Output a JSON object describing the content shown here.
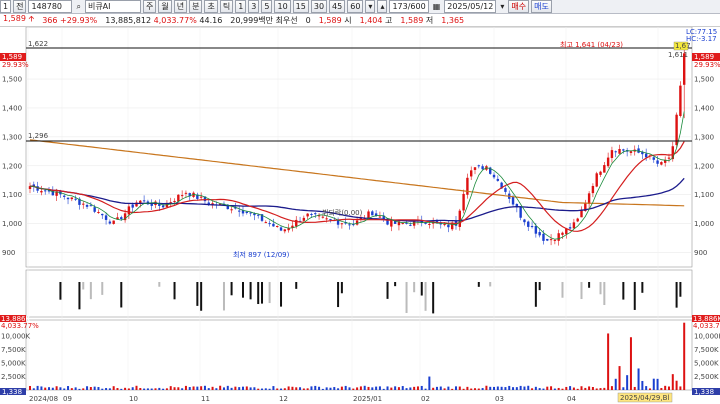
{
  "toolbar": {
    "period_selector": "1",
    "symbol_type": "전",
    "code": "148780",
    "name": "비큐AI",
    "periods": [
      "주",
      "월",
      "년",
      "분",
      "초",
      "틱"
    ],
    "intervals": [
      "1",
      "3",
      "5",
      "10",
      "15",
      "30",
      "45",
      "60"
    ],
    "counter": "173/600",
    "date": "2025/05/12",
    "buy_label": "매수",
    "sell_label": "매도"
  },
  "quote": {
    "price": "1,589",
    "change": "366",
    "change_pct": "+29.93%",
    "volume": "13,885,812",
    "volume_pct": "4,033.77%",
    "turnover_ratio": "44.16",
    "amount": "20,999백만",
    "priority_label": "최우선",
    "priority_value": "0",
    "open_value": "1,589",
    "open_label": "시",
    "high_value": "1,404",
    "high_label": "고",
    "low_value": "1,589",
    "low_label": "저",
    "low2_value": "1,365"
  },
  "indicators": {
    "lc": "LC:77.15",
    "hc": "HC:-3.17"
  },
  "price_axis": {
    "ticks": [
      "1,500",
      "1,400",
      "1,300",
      "1,200",
      "1,100",
      "1,000",
      "900"
    ],
    "current_price_tag": "1,589",
    "current_pct_tag": "29.93%",
    "high_tag": "1,67",
    "high_tag2": "1,611"
  },
  "annotations": {
    "line_1622": "1,622",
    "line_1296": "1,296",
    "highest": "최고 1,641 (04/23)",
    "lowest": "최저 897 (12/09)",
    "note": "뷔되락(0.00)"
  },
  "volume_axis": {
    "ticks": [
      "10,000K",
      "7,500K",
      "5,000K",
      "2,500K"
    ],
    "left_tag": "4,033.77%",
    "left_tag_vol": "13,886K",
    "right_tag_vol": "13,886K",
    "right_tag_pct": "4,033.77%",
    "bottom_left": "1,338",
    "bottom_right": "1,338"
  },
  "time_axis": {
    "labels": [
      "2024/08",
      "09",
      "10",
      "11",
      "12",
      "2025/01",
      "02",
      "03",
      "04",
      "05"
    ],
    "cursor_label": "2025/04/29,Bl"
  },
  "colors": {
    "up": "#dd1111",
    "down": "#1a3fd0",
    "ma_short": "#d41e1e",
    "ma_mid": "#1c1c8c",
    "ma_long": "#c8761e",
    "ma_fast": "#1a8a3a"
  }
}
